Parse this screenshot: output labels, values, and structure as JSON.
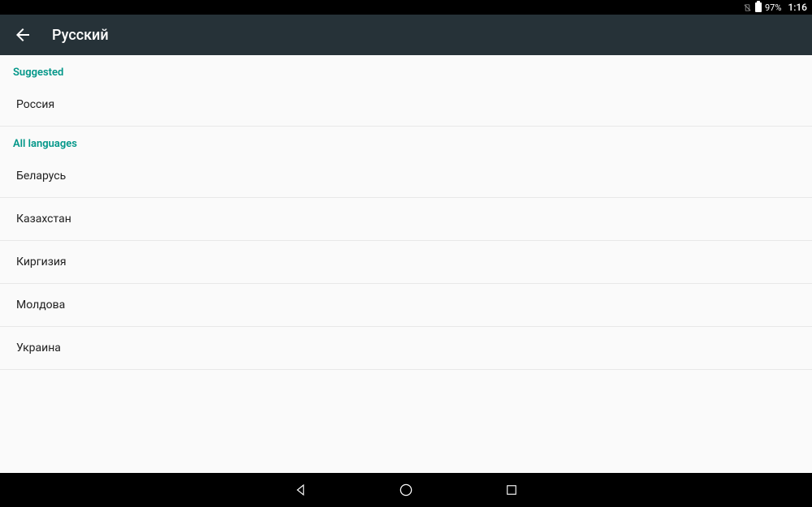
{
  "status": {
    "battery_percent": "97%",
    "time": "1:16"
  },
  "appbar": {
    "title": "Русский"
  },
  "sections": {
    "suggested_header": "Suggested",
    "all_header": "All languages"
  },
  "suggested_items": [
    "Россия"
  ],
  "all_items": [
    "Беларусь",
    "Казахстан",
    "Киргизия",
    "Молдова",
    "Украина"
  ]
}
